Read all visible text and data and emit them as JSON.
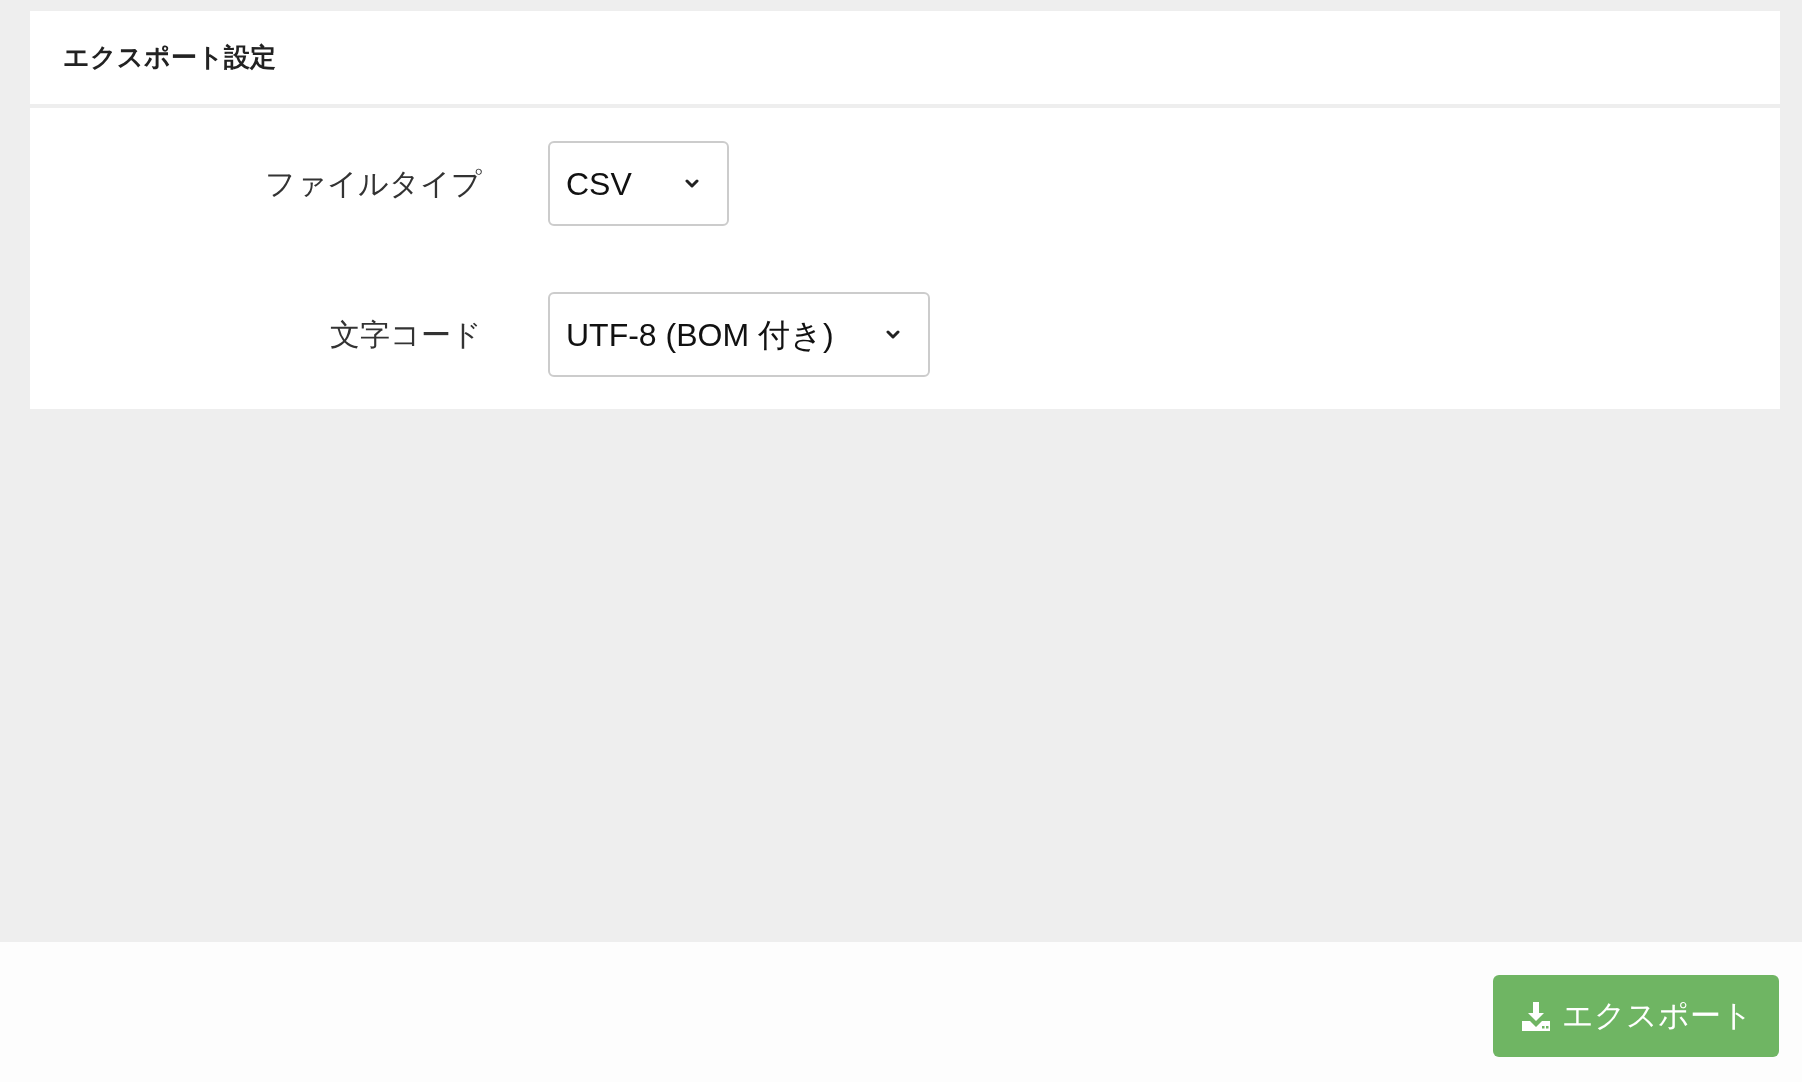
{
  "panel": {
    "title": "エクスポート設定"
  },
  "fields": [
    {
      "label": "ファイルタイプ",
      "value": "CSV"
    },
    {
      "label": "文字コード",
      "value": "UTF-8 (BOM 付き)"
    }
  ],
  "footer": {
    "export_button": {
      "label": "エクスポート"
    }
  }
}
